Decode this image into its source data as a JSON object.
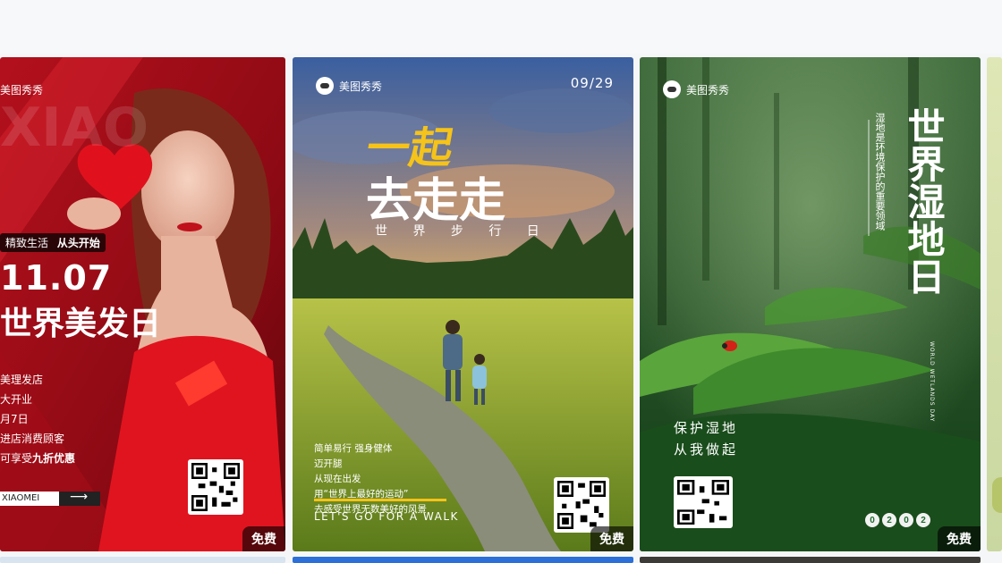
{
  "gallery": {
    "cards": [
      {
        "brand": "美图秀秀",
        "bg_text": "XIAO",
        "tagline_a": "精致生活",
        "tagline_b": "从头开始",
        "date": "11.07",
        "title": "世界美发日",
        "lines": [
          "美理发店",
          "大开业",
          "月7日",
          "进店消费顾客",
          "可享受"
        ],
        "highlight": "九折优惠",
        "shop_name": "XIAOMEI",
        "badge": "免费",
        "accent": "#c7141f"
      },
      {
        "brand": "美图秀秀",
        "date": "09/29",
        "headline_1": "一起",
        "headline_2": "去走走",
        "subtitle": "世 界 步 行 日",
        "lines": [
          "简单易行 强身健体",
          "迈开腿",
          "从现在出发",
          "用“世界上最好的运动”",
          "去感受世界无数美好的风景"
        ],
        "slogan": "LET'S GO FOR  A WALK",
        "badge": "免费",
        "accent": "#f5c319"
      },
      {
        "brand": "美图秀秀",
        "vertical_title": "世界湿地日",
        "vertical_sub": "湿地是环境保护的重要领域",
        "english": "WORLD WETLANDS DAY",
        "line_1": "保护湿地",
        "line_2": "从我做起",
        "digits": [
          "0",
          "2",
          "0",
          "2"
        ],
        "badge": "免费",
        "accent": "#1f6b2c"
      }
    ]
  }
}
